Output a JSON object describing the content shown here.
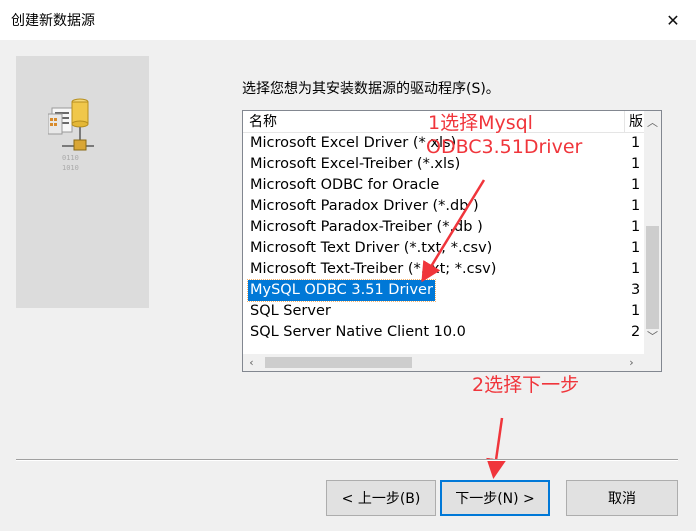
{
  "window": {
    "title": "创建新数据源"
  },
  "instruction": "选择您想为其安装数据源的驱动程序(S)。",
  "list": {
    "columns": {
      "name": "名称",
      "version": "版"
    },
    "rows": [
      {
        "name": "Microsoft Excel Driver (*.xls)",
        "version": "1",
        "selected": false
      },
      {
        "name": "Microsoft Excel-Treiber (*.xls)",
        "version": "1",
        "selected": false
      },
      {
        "name": "Microsoft ODBC for Oracle",
        "version": "1",
        "selected": false
      },
      {
        "name": "Microsoft Paradox Driver (*.db )",
        "version": "1",
        "selected": false
      },
      {
        "name": "Microsoft Paradox-Treiber (*.db )",
        "version": "1",
        "selected": false
      },
      {
        "name": "Microsoft Text Driver (*.txt; *.csv)",
        "version": "1",
        "selected": false
      },
      {
        "name": "Microsoft Text-Treiber (*.txt; *.csv)",
        "version": "1",
        "selected": false
      },
      {
        "name": "MySQL ODBC 3.51 Driver",
        "version": "3",
        "selected": true
      },
      {
        "name": "SQL Server",
        "version": "1",
        "selected": false
      },
      {
        "name": "SQL Server Native Client 10.0",
        "version": "2",
        "selected": false
      }
    ]
  },
  "annotations": {
    "step1_line1": "1选择Mysql",
    "step1_line2": "ODBC3.51Driver",
    "step2": "2选择下一步"
  },
  "buttons": {
    "back": "< 上一步(B)",
    "next": "下一步(N) >",
    "cancel": "取消"
  },
  "icons": {
    "close": "close-icon",
    "datasource": "database-datasource-icon"
  },
  "colors": {
    "selection": "#0078d7",
    "annotation": "#f0353b"
  }
}
